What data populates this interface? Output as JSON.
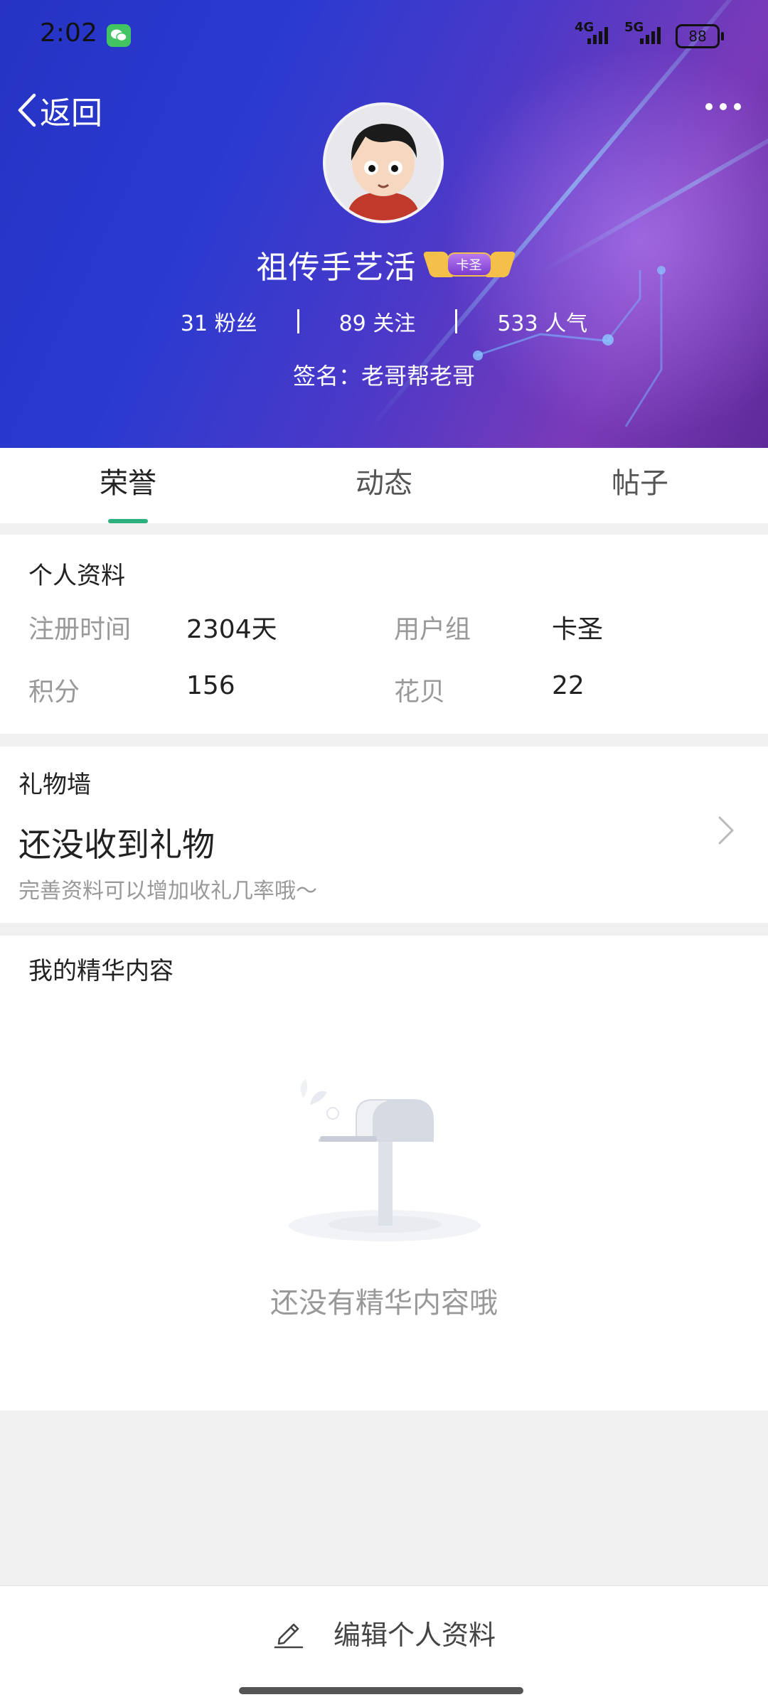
{
  "status_bar": {
    "time": "2:02",
    "network_1": "4G",
    "network_2": "5G",
    "battery": "88"
  },
  "header": {
    "back_label": "返回",
    "more_icon": "more-dots-icon",
    "username": "祖传手艺活",
    "badge_label": "卡圣",
    "stats": [
      {
        "value": "31",
        "label": "粉丝"
      },
      {
        "value": "89",
        "label": "关注"
      },
      {
        "value": "533",
        "label": "人气"
      }
    ],
    "signature": "签名：老哥帮老哥"
  },
  "tabs": [
    {
      "label": "荣誉",
      "active": true
    },
    {
      "label": "动态",
      "active": false
    },
    {
      "label": "帖子",
      "active": false
    }
  ],
  "profile": {
    "title": "个人资料",
    "fields": [
      {
        "key": "注册时间",
        "value": "2304天"
      },
      {
        "key": "用户组",
        "value": "卡圣"
      },
      {
        "key": "积分",
        "value": "156"
      },
      {
        "key": "花贝",
        "value": "22"
      }
    ]
  },
  "gift_wall": {
    "title": "礼物墙",
    "headline": "还没收到礼物",
    "subtitle": "完善资料可以增加收礼几率哦～"
  },
  "essence": {
    "title": "我的精华内容",
    "empty_text": "还没有精华内容哦"
  },
  "bottom": {
    "edit_label": "编辑个人资料",
    "edit_icon": "pencil-icon"
  },
  "colors": {
    "accent": "#2bb07e",
    "header_gradient_start": "#2633c4",
    "header_gradient_end": "#7a3ab8"
  }
}
